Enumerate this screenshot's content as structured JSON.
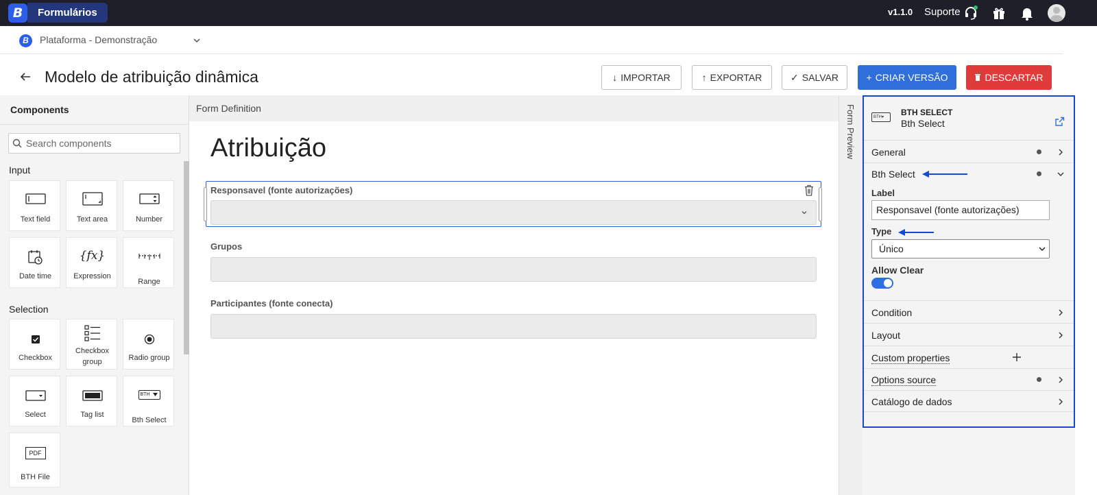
{
  "topbar": {
    "brand_initial": "B",
    "brand_name": "Formulários",
    "version": "v1.1.0",
    "support_label": "Suporte",
    "icons": [
      "headset-icon",
      "gift-icon",
      "bell-icon",
      "avatar"
    ]
  },
  "context": {
    "initial": "B",
    "name": "Plataforma - Demonstração"
  },
  "header": {
    "title": "Modelo de atribuição dinâmica",
    "buttons": {
      "import": "IMPORTAR",
      "export": "EXPORTAR",
      "save": "SALVAR",
      "create_version": "CRIAR VERSÃO",
      "discard": "DESCARTAR"
    }
  },
  "components_panel": {
    "title": "Components",
    "search_placeholder": "Search components",
    "sections": {
      "input": "Input",
      "selection": "Selection"
    },
    "items": {
      "text_field": "Text field",
      "text_area": "Text area",
      "number": "Number",
      "date_time": "Date time",
      "expression": "Expression",
      "range": "Range",
      "checkbox": "Checkbox",
      "checkbox_group": "Checkbox group",
      "radio_group": "Radio group",
      "select": "Select",
      "tag_list": "Tag list",
      "bth_select": "Bth Select",
      "bth_file": "BTH File"
    },
    "icon_text": {
      "expression": "{fx}",
      "bth": "BTH",
      "pdf": "PDF"
    }
  },
  "form_definition": {
    "header": "Form Definition",
    "title": "Atribuição",
    "fields": [
      {
        "label": "Responsavel (fonte autorizações)"
      },
      {
        "label": "Grupos"
      },
      {
        "label": "Participantes (fonte conecta)"
      }
    ]
  },
  "form_preview": {
    "label": "Form Preview"
  },
  "properties": {
    "icon_text": "BTH",
    "component_type": "BTH SELECT",
    "component_name": "Bth Select",
    "sections": {
      "general": "General",
      "bth_select": "Bth Select",
      "condition": "Condition",
      "layout": "Layout",
      "custom_properties": "Custom properties",
      "options_source": "Options source",
      "catalogo": "Catálogo de dados"
    },
    "label_field": {
      "label": "Label",
      "value": "Responsavel (fonte autorizações)"
    },
    "type_field": {
      "label": "Type",
      "value": "Único"
    },
    "allow_clear": {
      "label": "Allow Clear",
      "value": true
    }
  },
  "colors": {
    "topbar": "#1f1f2a",
    "brand": "#2d5ee8",
    "primary_button": "#2f6fdb",
    "danger_button": "#e03b3b",
    "highlight_border": "#1449d8"
  }
}
